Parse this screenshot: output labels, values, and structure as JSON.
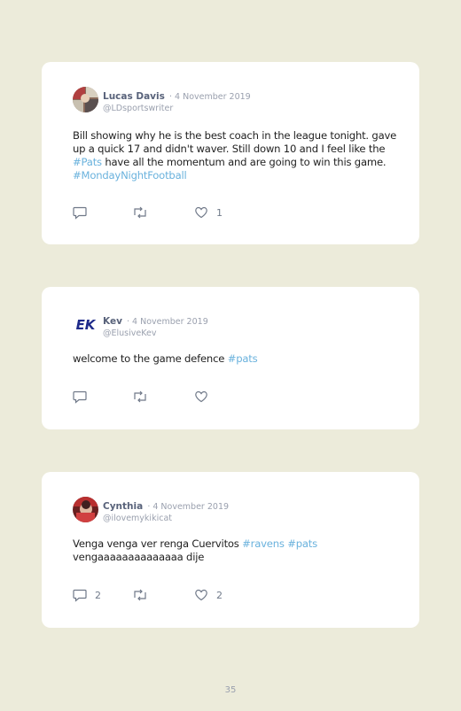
{
  "tweets": [
    {
      "name": "Lucas Davis",
      "date": "· 4 November 2019",
      "handle": "@LDsportswriter",
      "body": {
        "t1": "Bill showing why he is the best coach in the league tonight. gave up a quick 17 and didn't waver. Still down 10 and I feel like the ",
        "tag1": "#Pats",
        "t2": " have all the momentum and are going to win this game. ",
        "tag2": "#MondayNightFootball"
      },
      "replies": "",
      "retweets": "",
      "likes": "1"
    },
    {
      "name": "Kev",
      "date": "· 4 November 2019",
      "handle": "@ElusiveKev",
      "avatar_text": "EK",
      "body": {
        "t1": "welcome to the game defence ",
        "tag1": "#pats"
      },
      "replies": "",
      "retweets": "",
      "likes": ""
    },
    {
      "name": "Cynthia",
      "date": "· 4 November 2019",
      "handle": "@ilovemykikicat",
      "body": {
        "t1": "Venga venga ver renga Cuervitos ",
        "tag1": "#ravens",
        "t2": " ",
        "tag2": "#pats",
        "t3": " vengaaaaaaaaaaaaaa dije"
      },
      "replies": "2",
      "retweets": "",
      "likes": "2"
    }
  ],
  "page_number": "35",
  "colors": {
    "background": "#ecebda",
    "card": "#ffffff",
    "hashtag": "#6ab2dd",
    "name": "#58627a",
    "muted": "#9aa0ae"
  },
  "icons": [
    "reply-icon",
    "retweet-icon",
    "like-icon"
  ]
}
